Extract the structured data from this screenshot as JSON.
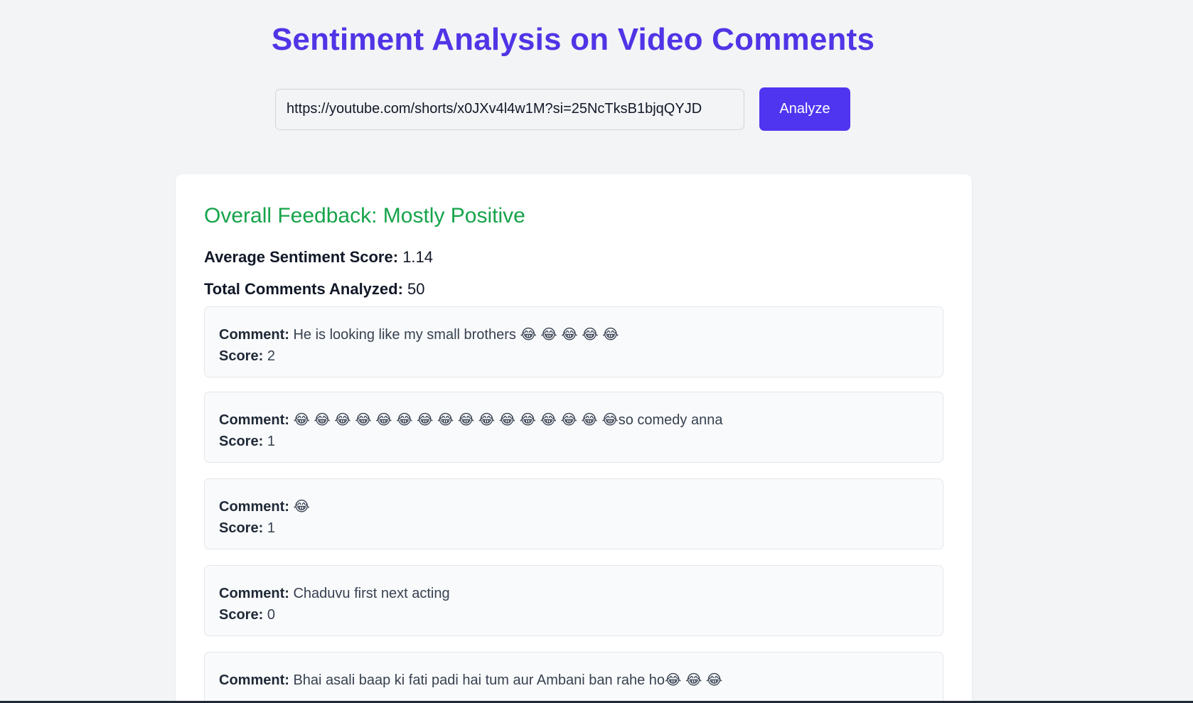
{
  "header": {
    "title": "Sentiment Analysis on Video Comments"
  },
  "search": {
    "value": "https://youtube.com/shorts/x0JXv4l4w1M?si=25NcTksB1bjqQYJD",
    "button_label": "Analyze"
  },
  "results": {
    "overall_feedback": "Overall Feedback: Mostly Positive",
    "average_label": "Average Sentiment Score:",
    "average_value": "1.14",
    "total_label": "Total Comments Analyzed:",
    "total_value": "50",
    "comment_label": "Comment:",
    "score_label": "Score:",
    "comments": [
      {
        "text": "He is looking like my small brothers 😂 😂 😂 😂 😂",
        "score": "2"
      },
      {
        "text": "😂 😂 😂 😂 😂 😂 😂 😂 😂 😂 😂 😂 😂 😂 😂 😂so comedy anna",
        "score": "1"
      },
      {
        "text": "😂",
        "score": "1"
      },
      {
        "text": "Chaduvu first next acting",
        "score": "0"
      },
      {
        "text": "Bhai asali baap ki fati padi hai tum aur Ambani ban rahe ho😂 😂 😂",
        "score": ""
      }
    ]
  },
  "colors": {
    "title": "#4f35e6",
    "button": "#4f35f0",
    "positive": "#16a34a",
    "background": "#f3f4f6"
  }
}
